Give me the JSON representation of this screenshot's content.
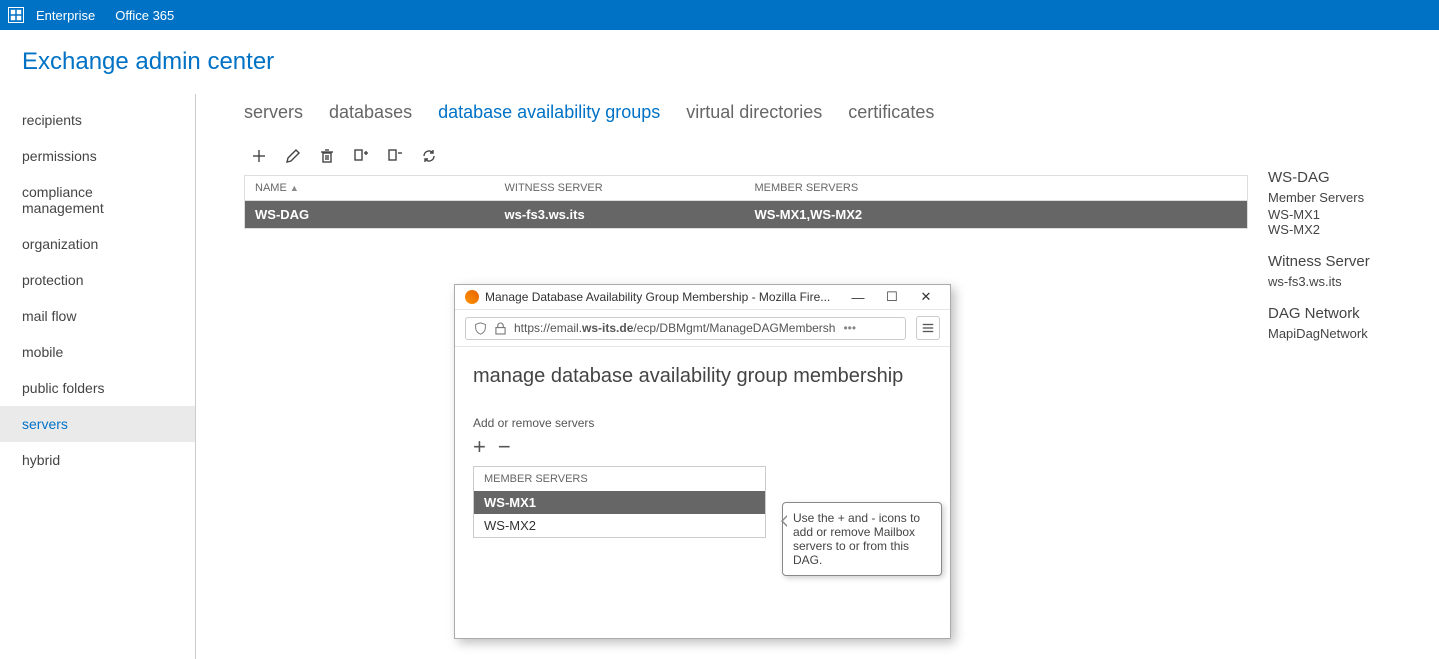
{
  "topbar": {
    "link_enterprise": "Enterprise",
    "link_office365": "Office 365"
  },
  "page_title": "Exchange admin center",
  "sidebar": {
    "items": [
      {
        "label": "recipients"
      },
      {
        "label": "permissions"
      },
      {
        "label": "compliance management"
      },
      {
        "label": "organization"
      },
      {
        "label": "protection"
      },
      {
        "label": "mail flow"
      },
      {
        "label": "mobile"
      },
      {
        "label": "public folders"
      },
      {
        "label": "servers"
      },
      {
        "label": "hybrid"
      }
    ],
    "active_index": 8
  },
  "tabs": {
    "items": [
      {
        "label": "servers"
      },
      {
        "label": "databases"
      },
      {
        "label": "database availability groups"
      },
      {
        "label": "virtual directories"
      },
      {
        "label": "certificates"
      }
    ],
    "active_index": 2
  },
  "grid": {
    "columns": {
      "c0": "NAME",
      "c1": "WITNESS SERVER",
      "c2": "MEMBER SERVERS"
    },
    "rows": [
      {
        "name": "WS-DAG",
        "witness": "ws-fs3.ws.its",
        "members": "WS-MX1,WS-MX2",
        "selected": true
      }
    ]
  },
  "details": {
    "title": "WS-DAG",
    "members_label": "Member Servers",
    "members_l1": "WS-MX1",
    "members_l2": "WS-MX2",
    "witness_label": "Witness Server",
    "witness_value": "ws-fs3.ws.its",
    "network_label": "DAG Network",
    "network_value": "MapiDagNetwork"
  },
  "popup": {
    "window_title": "Manage Database Availability Group Membership - Mozilla Fire...",
    "url_prefix": "https://email.",
    "url_bold": "ws-its.de",
    "url_suffix": "/ecp/DBMgmt/ManageDAGMembersh",
    "heading": "manage database availability group membership",
    "sub": "Add or remove servers",
    "col_header": "MEMBER SERVERS",
    "rows": [
      {
        "label": "WS-MX1",
        "selected": true
      },
      {
        "label": "WS-MX2",
        "selected": false
      }
    ],
    "tooltip": "Use the + and - icons to add or remove Mailbox servers to or from this DAG."
  }
}
